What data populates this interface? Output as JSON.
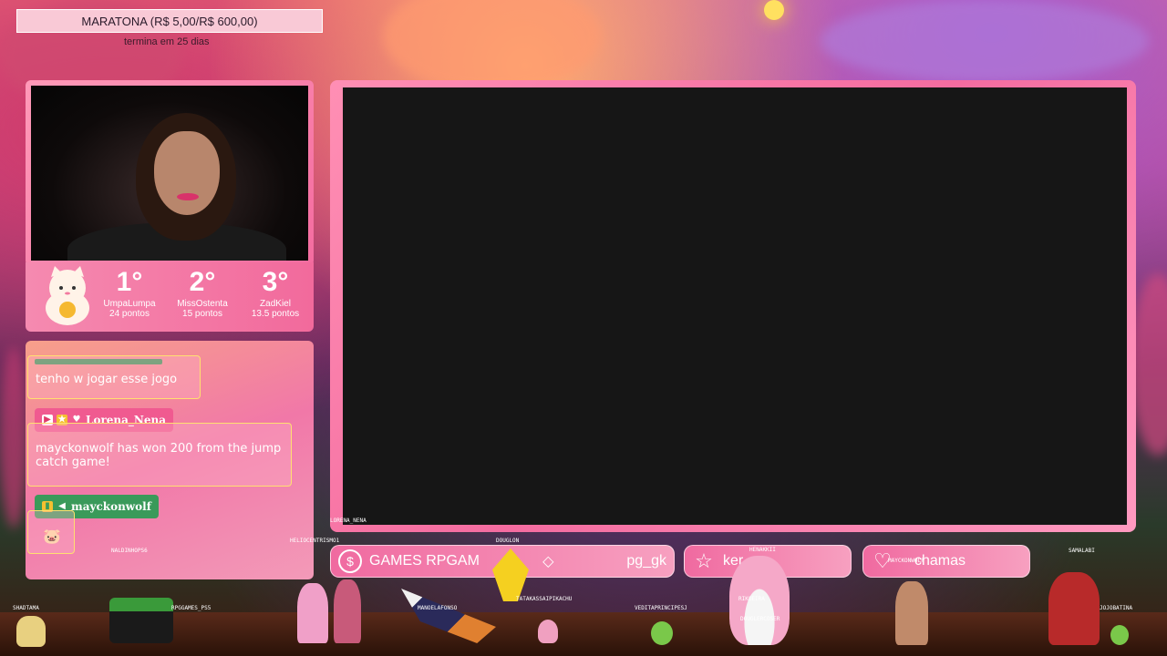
{
  "goal": {
    "title": "MARATONA (R$ 5,00/R$ 600,00)",
    "subtitle": "termina em 25 dias"
  },
  "leaderboard": [
    {
      "pos": "1°",
      "name": "UmpaLumpa",
      "points": "24 pontos"
    },
    {
      "pos": "2°",
      "name": "MissOstenta",
      "points": "15 pontos"
    },
    {
      "pos": "3°",
      "name": "ZadKiel",
      "points": "13.5 pontos"
    }
  ],
  "chat": {
    "msg1": "tenho w jogar esse jogo",
    "user2": "Lorena_Nena",
    "msg2": "mayckonwolf has won 200 from the jump catch game!",
    "user3": "mayckonwolf"
  },
  "game_label": "LORENA_NENA",
  "bottom_bar": {
    "pill1_left": "GAMES   RPGAM",
    "pill1_right": "pg_gk",
    "pill2": "ker",
    "pill3": "chamas"
  },
  "sprites": [
    "SHADTAMA",
    "RPGGAMES_PS5",
    "NALDINHOPS6",
    "HELIOCENTRISMO1",
    "DOUGLON",
    "MANOELAFONSO",
    "TATAKASSAIPIKACHU",
    "VEDITAPRINCIPESJ",
    "HENAKKII",
    "RIKOEIRA",
    "DOUGLERCOSER",
    "MAYCKONWOLF",
    "SAMALABI",
    "JOJOBATINA"
  ],
  "colors": {
    "accent": "#f46ca0",
    "frame_light": "#ff9ab8",
    "game_bg": "#161616",
    "chat_border": "#ffe070",
    "user_tag_pink": "#f05a90",
    "user_tag_green": "#3a9a5a"
  }
}
